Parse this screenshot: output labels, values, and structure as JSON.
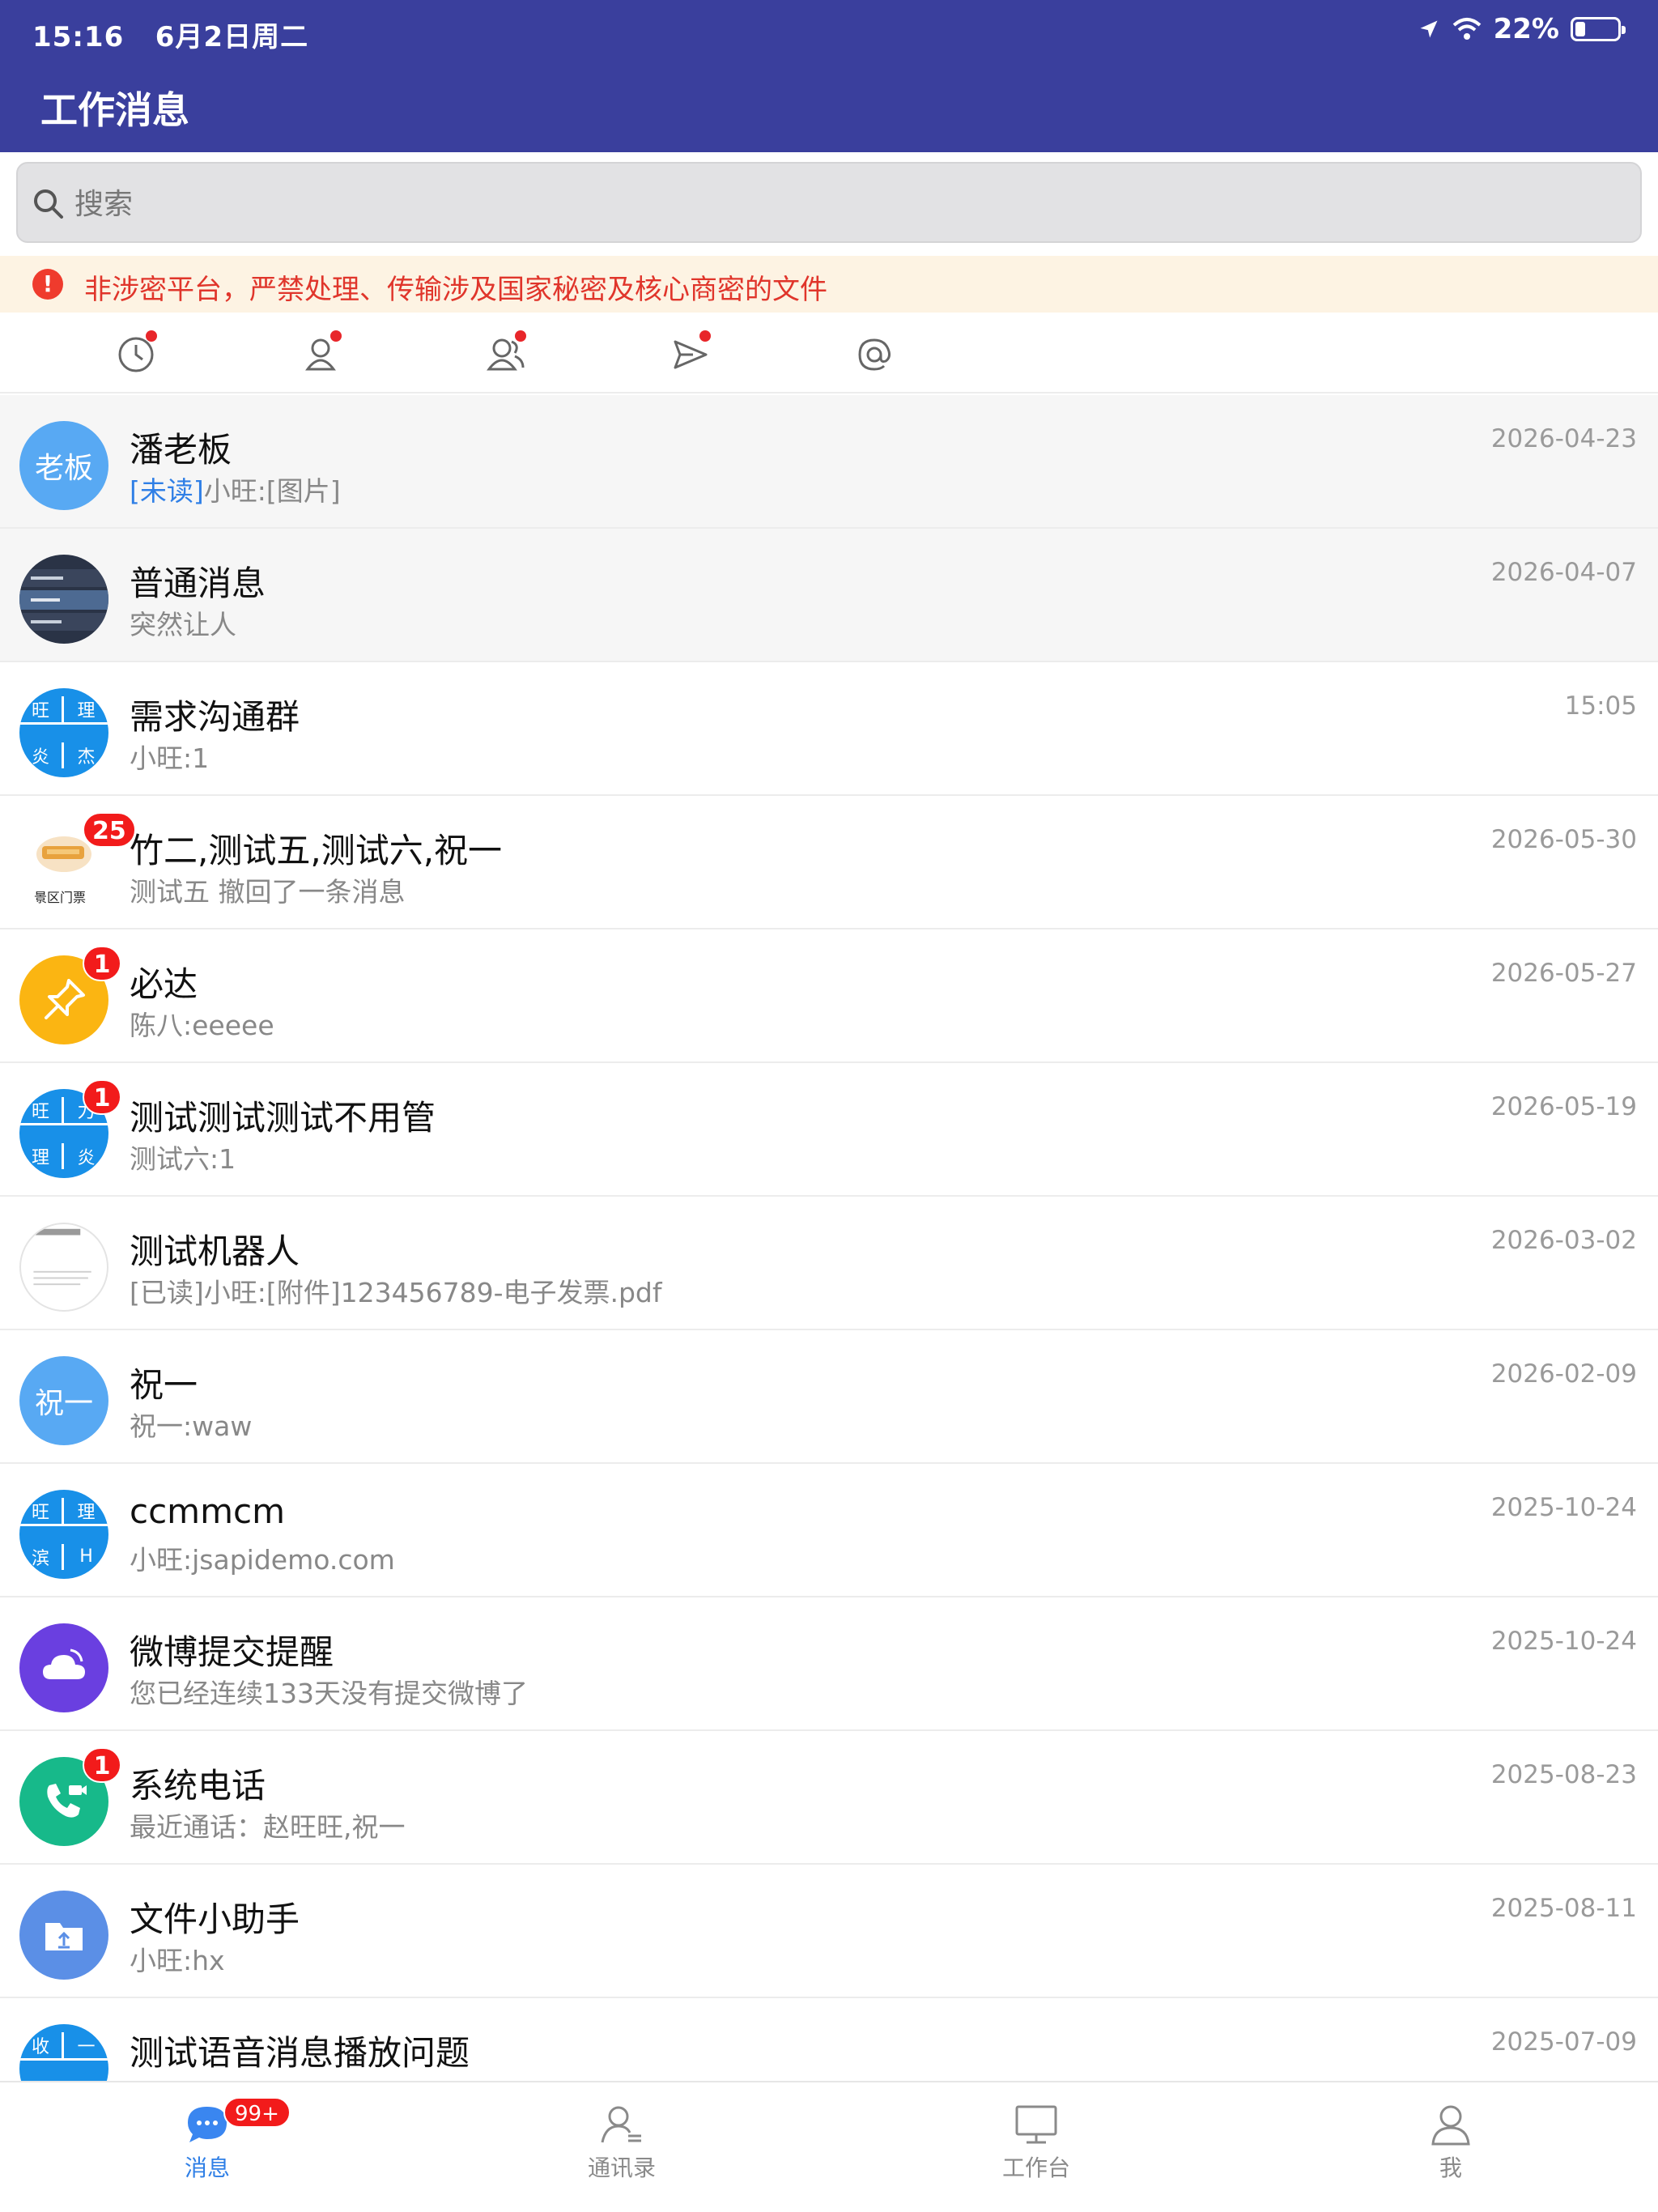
{
  "status_bar": {
    "time": "15:16",
    "date": "6月2日周二",
    "battery": "22%",
    "battery_level": 0.22
  },
  "header": {
    "title": "工作消息"
  },
  "search": {
    "placeholder": "搜索"
  },
  "notice": {
    "text": "非涉密平台，严禁处理、传输涉及国家秘密及核心商密的文件"
  },
  "filters": [
    {
      "icon": "clock-icon",
      "has_dot": true
    },
    {
      "icon": "person-icon",
      "has_dot": true
    },
    {
      "icon": "group-icon",
      "has_dot": true
    },
    {
      "icon": "send-icon",
      "has_dot": true
    },
    {
      "icon": "at-icon",
      "has_dot": false
    }
  ],
  "conversations": [
    {
      "name": "潘老板",
      "preview_tag": "[未读]",
      "preview": "小旺:[图片]",
      "date": "2026-04-23",
      "avatar_text": "老板",
      "pinned": true
    },
    {
      "name": "普通消息",
      "preview_tag": "",
      "preview": "突然让人",
      "date": "2026-04-07",
      "pinned": true
    },
    {
      "name": "需求沟通群",
      "preview_tag": "",
      "preview": "小旺:1",
      "date": "15:05",
      "grid": [
        "旺",
        "理",
        "炎",
        "杰"
      ]
    },
    {
      "name": "竹二,测试五,测试六,祝一",
      "preview_tag": "",
      "preview": "测试五 撤回了一条消息",
      "date": "2026-05-30",
      "badge": "25",
      "avatar_caption": "景区门票"
    },
    {
      "name": "必达",
      "preview_tag": "",
      "preview": "陈八:eeeee",
      "date": "2026-05-27",
      "badge": "1"
    },
    {
      "name": "测试测试测试不用管",
      "preview_tag": "",
      "preview": "测试六:1",
      "date": "2026-05-19",
      "badge": "1",
      "grid": [
        "旺",
        "力",
        "理",
        "炎"
      ]
    },
    {
      "name": "测试机器人",
      "preview_tag": "",
      "preview": "[已读]小旺:[附件]123456789-电子发票.pdf",
      "date": "2026-03-02"
    },
    {
      "name": "祝一",
      "preview_tag": "",
      "preview": "祝一:waw",
      "date": "2026-02-09",
      "avatar_text": "祝一"
    },
    {
      "name": "ccmmcm",
      "preview_tag": "",
      "preview": "小旺:jsapidemo.com",
      "date": "2025-10-24",
      "grid": [
        "旺",
        "理",
        "滨",
        "H"
      ]
    },
    {
      "name": "微博提交提醒",
      "preview_tag": "",
      "preview": "您已经连续133天没有提交微博了",
      "date": "2025-10-24"
    },
    {
      "name": "系统电话",
      "preview_tag": "",
      "preview": "最近通话：赵旺旺,祝一",
      "date": "2025-08-23",
      "badge": "1"
    },
    {
      "name": "文件小助手",
      "preview_tag": "",
      "preview": "小旺:hx",
      "date": "2025-08-11"
    },
    {
      "name": "测试语音消息播放问题",
      "preview_tag": "",
      "preview": "",
      "date": "2025-07-09",
      "grid": [
        "收",
        "一",
        "",
        ""
      ]
    }
  ],
  "tabbar": {
    "tabs": [
      {
        "label": "消息",
        "active": true,
        "badge": "99+"
      },
      {
        "label": "通讯录",
        "active": false
      },
      {
        "label": "工作台",
        "active": false
      },
      {
        "label": "我",
        "active": false
      }
    ]
  },
  "colors": {
    "header_bg": "#3a3f9d",
    "accent": "#2f7fe6",
    "badge": "#f21b1b",
    "warning": "#e0352b"
  }
}
